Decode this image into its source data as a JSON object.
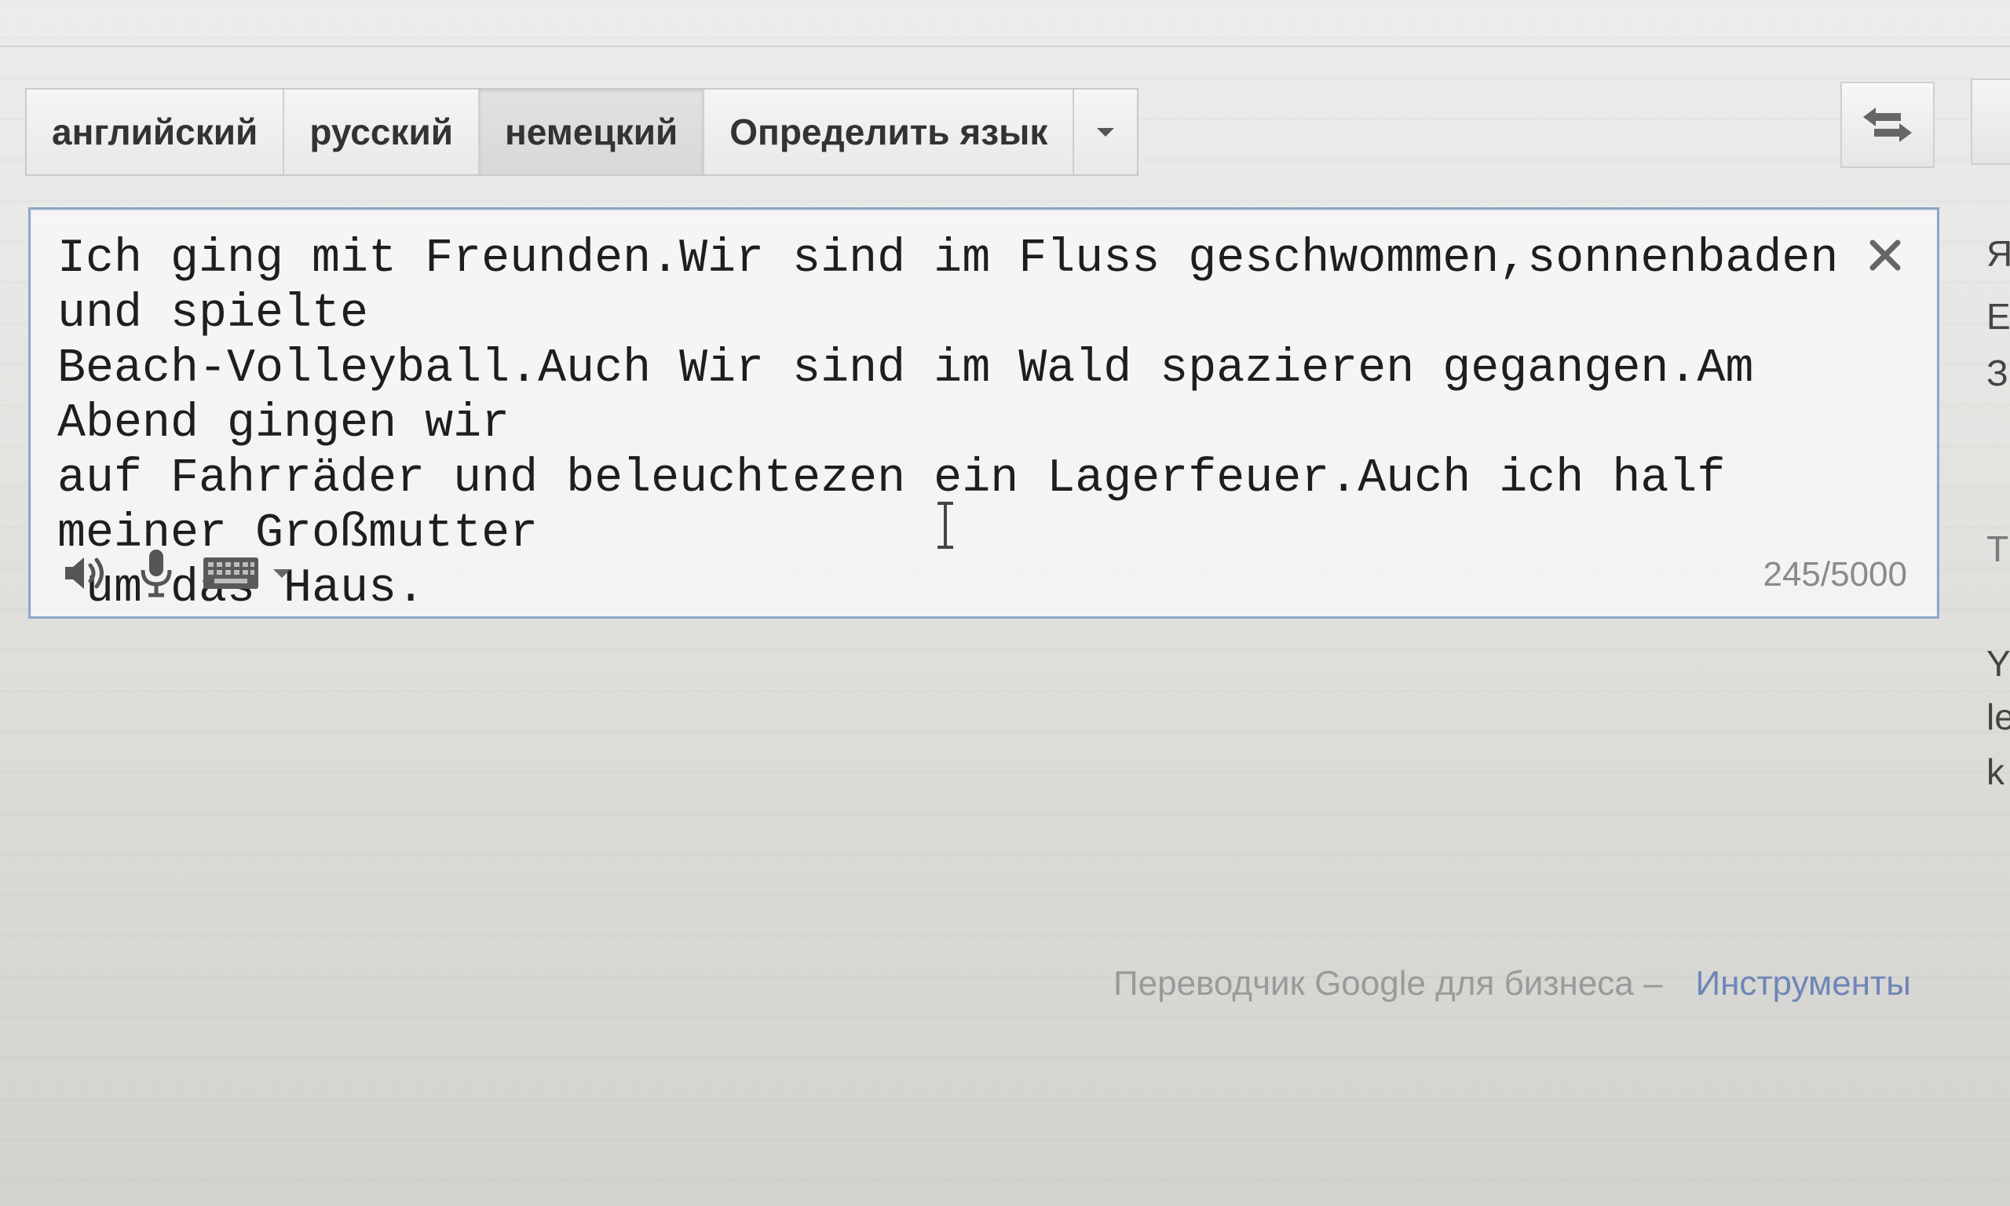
{
  "language_tabs": [
    {
      "label": "английский",
      "selected": false
    },
    {
      "label": "русский",
      "selected": false
    },
    {
      "label": "немецкий",
      "selected": true
    },
    {
      "label": "Определить язык",
      "selected": false
    }
  ],
  "source": {
    "text": "Ich ging mit Freunden.Wir sind im Fluss geschwommen,sonnenbaden und spielte\nBeach-Volleyball.Auch Wir sind im Wald spazieren gegangen.Am Abend gingen wir\nauf Fahrräder und beleuchtezen ein Lagerfeuer.Auch ich half meiner Großmutter\n um das Haus.",
    "char_count": "245/5000"
  },
  "icons": {
    "swap": "swap-languages-icon",
    "clear": "close-icon",
    "listen": "speaker-icon",
    "voice": "microphone-icon",
    "keyboard": "keyboard-icon",
    "keyboard_menu": "chevron-down-icon",
    "cursor": "text-cursor-icon"
  },
  "right_column_peek": [
    "Я",
    "Е",
    "З",
    "Т",
    "Y/",
    "le",
    "k"
  ],
  "footer": {
    "text": "Переводчик Google для бизнеса –",
    "link": "Инструменты"
  },
  "colors": {
    "box_border": "#8ea6c9",
    "link": "#6e86b8"
  }
}
